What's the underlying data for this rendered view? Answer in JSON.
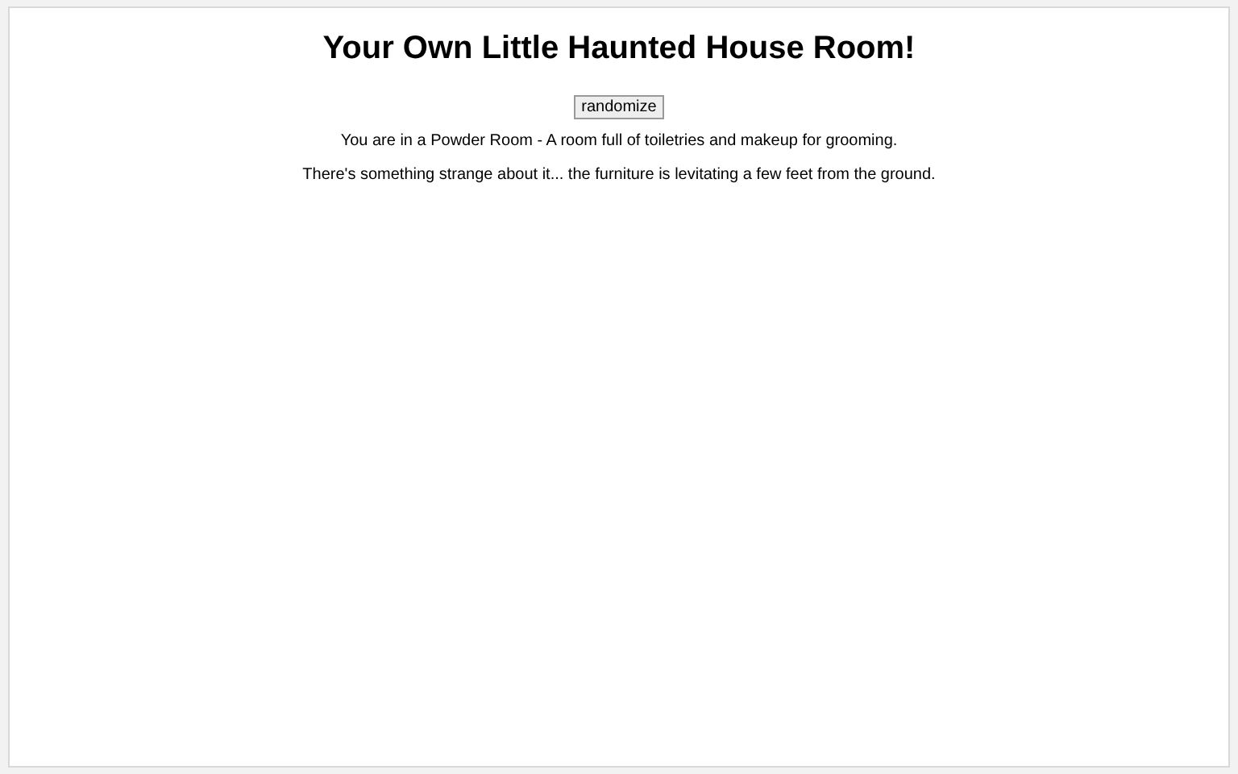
{
  "title": "Your Own Little Haunted House Room!",
  "button": "randomize",
  "paragraphs": [
    "You are in a Powder Room - A room full of toiletries and makeup for grooming.",
    "There's something strange about it... the furniture is levitating a few feet from the ground."
  ]
}
